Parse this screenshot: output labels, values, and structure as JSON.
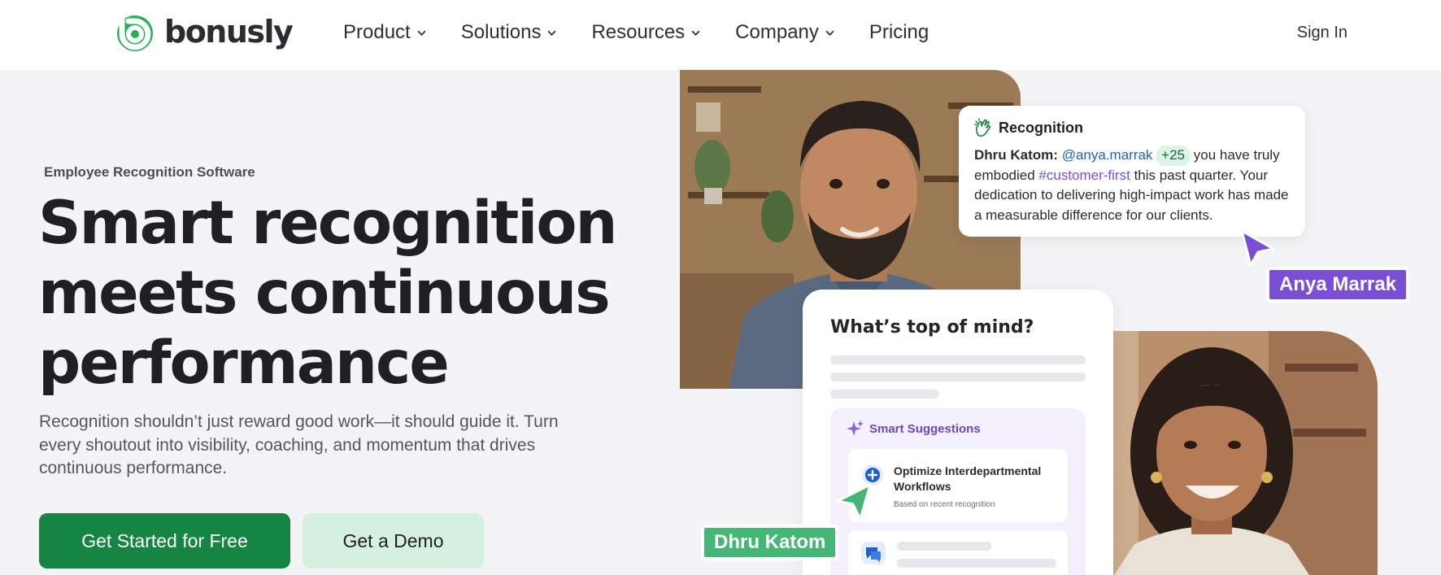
{
  "brand": {
    "name": "bonusly",
    "primary": "#168442",
    "purple": "#7a4fd6",
    "green_tag": "#45b676"
  },
  "nav": {
    "items": [
      {
        "label": "Product",
        "has_dropdown": true
      },
      {
        "label": "Solutions",
        "has_dropdown": true
      },
      {
        "label": "Resources",
        "has_dropdown": true
      },
      {
        "label": "Company",
        "has_dropdown": true
      },
      {
        "label": "Pricing",
        "has_dropdown": false
      }
    ],
    "sign_in": "Sign In"
  },
  "hero": {
    "eyebrow": "Employee Recognition Software",
    "headline": [
      "Smart recognition",
      "meets continuous",
      "performance"
    ],
    "subtext": "Recognition shouldn’t just reward good work—it should guide it. Turn every shoutout into visibility, coaching, and momentum that drives continuous performance.",
    "cta_primary": "Get Started for Free",
    "cta_secondary": "Get a Demo"
  },
  "recognition_card": {
    "title": "Recognition",
    "icon": "clapping-hands-icon",
    "author": "Dhru Katom:",
    "mention": "@anya.marrak",
    "points": "+25",
    "text_before_tag": "you have truly embodied",
    "hashtag": "#customer-first",
    "text_after_tag": "this past quarter. Your dedication to delivering high-impact work has made a measurable difference for our clients."
  },
  "cursor_tags": {
    "anya": "Anya Marrak",
    "dhru": "Dhru Katom"
  },
  "top_of_mind_card": {
    "title": "What’s top of mind?",
    "suggestions_title": "Smart Suggestions",
    "suggestion": {
      "title": "Optimize Interdepartmental Workflows",
      "note": "Based on recent recognition"
    }
  }
}
